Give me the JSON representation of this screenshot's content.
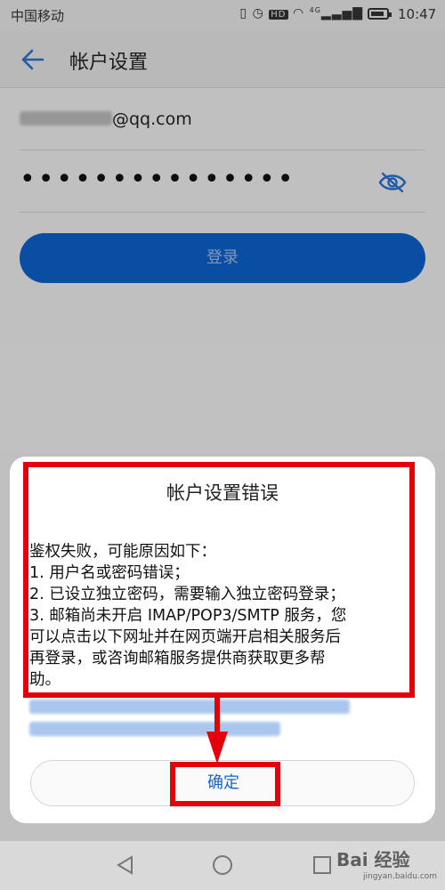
{
  "status_bar": {
    "carrier": "中国移动",
    "icons": [
      "vibrate-icon",
      "alarm-icon",
      "hd-icon",
      "wifi-icon",
      "4g-signal-icon",
      "battery-icon"
    ],
    "hd_text": "HD",
    "net_text": "4G",
    "time": "10:47",
    "battery_level": 0.85
  },
  "header": {
    "title": "帐户设置",
    "back_icon": "arrow-left-icon"
  },
  "form": {
    "email_domain": "@qq.com",
    "password_mask": "•••••••••••••••",
    "eye_icon": "eye-off-icon",
    "login_label": "登录"
  },
  "dialog": {
    "title": "帐户设置错误",
    "message_lines": [
      "鉴权失败，可能原因如下：",
      "1. 用户名或密码错误；",
      "2. 已设立独立密码，需要输入独立密码登录；",
      "3. 邮箱尚未开启 IMAP/POP3/SMTP 服务，您",
      "可以点击以下网址并在网页端开启相关服务后",
      "再登录，或咨询邮箱服务提供商获取更多帮",
      "助。"
    ],
    "ok_label": "确定"
  },
  "navbar": {
    "icons": [
      "back-triangle-icon",
      "home-circle-icon",
      "recents-square-icon"
    ]
  },
  "watermark": {
    "text": "Bai 经验",
    "sub": "jingyan.baidu.com"
  },
  "colors": {
    "accent": "#0d60c9",
    "annotation": "#e3000b"
  }
}
